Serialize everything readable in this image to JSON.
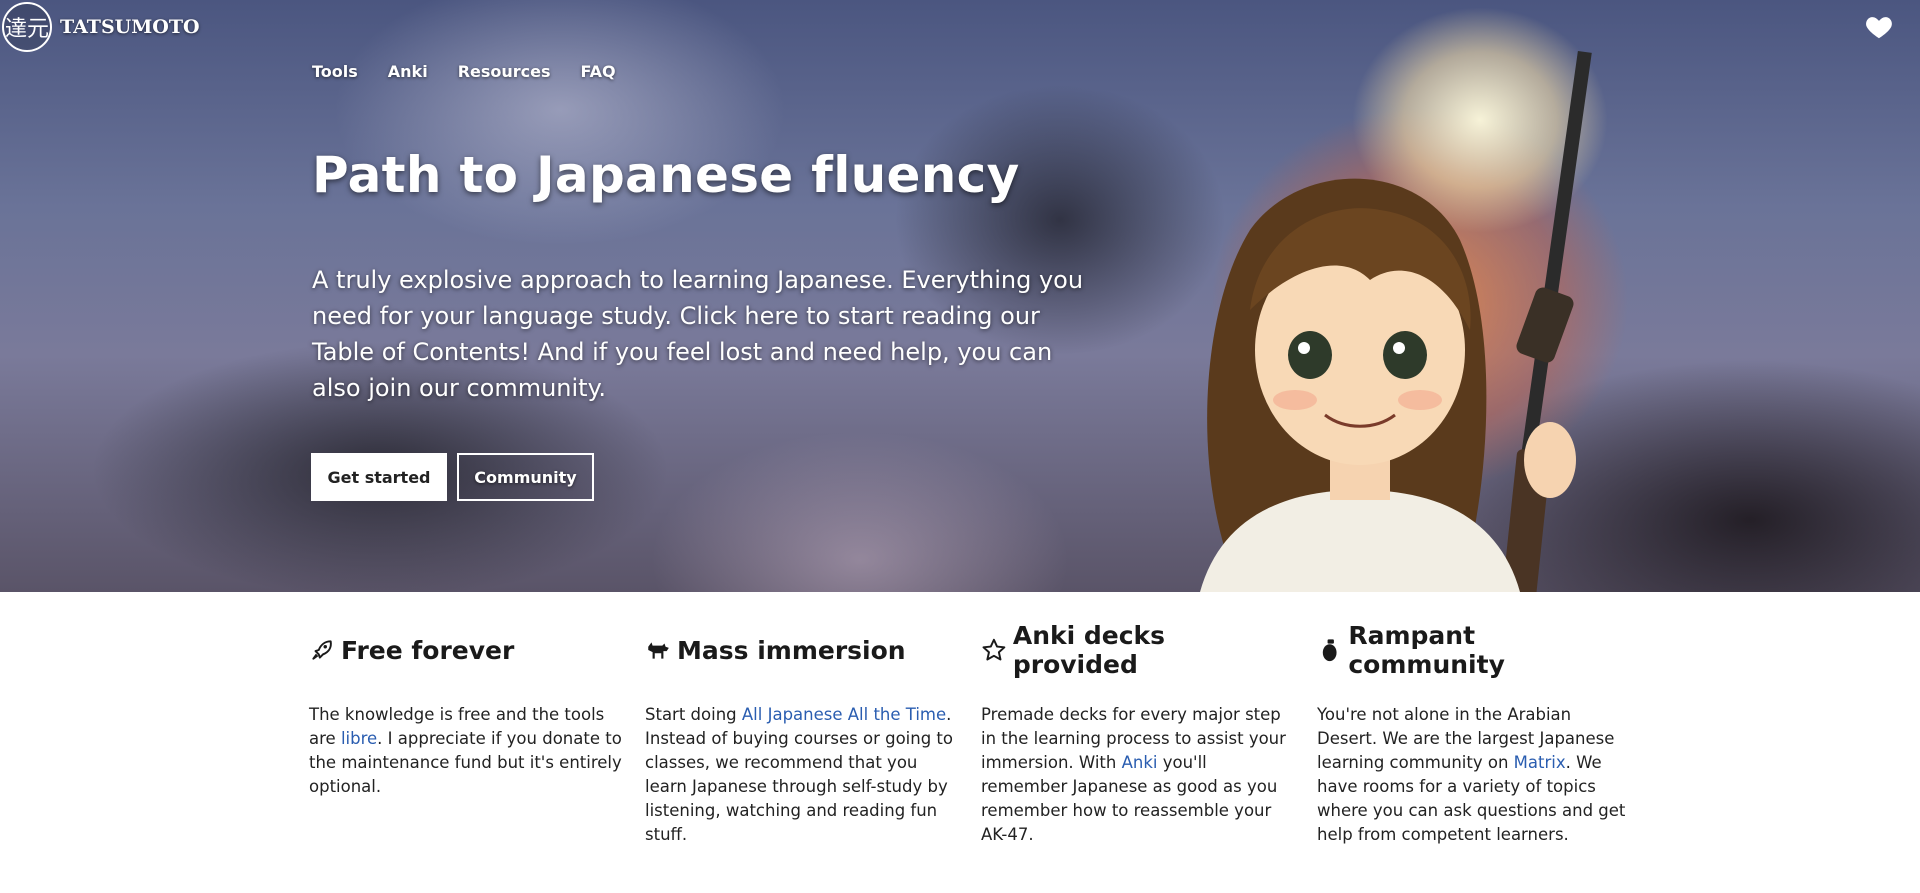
{
  "brand": {
    "mark": "達元",
    "name": "TATSUMOTO"
  },
  "nav": [
    {
      "label": "Tools"
    },
    {
      "label": "Anki"
    },
    {
      "label": "Resources"
    },
    {
      "label": "FAQ"
    }
  ],
  "hero": {
    "title": "Path to Japanese fluency",
    "lead": "A truly explosive approach to learning Japanese. Everything you need for your language study. Click here to start reading our Table of Contents! And if you feel lost and need help, you can also join our community.",
    "primary_button": "Get started",
    "secondary_button": "Community"
  },
  "features": [
    {
      "icon": "rocket-icon",
      "title": "Free forever",
      "p1": "The knowledge is free and the tools are ",
      "link": "libre",
      "p2": ". I appreciate if you donate to the maintenance fund but it's entirely optional."
    },
    {
      "icon": "goat-icon",
      "title": "Mass immersion",
      "p1": "Start doing ",
      "link": "All Japanese All the Time",
      "p2": ". Instead of buying courses or going to classes, we recommend that you learn Japanese through self-study by listening, watching and reading fun stuff."
    },
    {
      "icon": "star-icon",
      "title": "Anki decks provided",
      "p1": "Premade decks for every major step in the learning process to assist your immersion. With ",
      "link": "Anki",
      "p2": " you'll remember Japanese as good as you remember how to reassemble your AK-47."
    },
    {
      "icon": "grenade-icon",
      "title": "Rampant community",
      "p1": "You're not alone in the Arabian Desert. We are the largest Japanese learning community on ",
      "link": "Matrix",
      "p2": ". We have rooms for a variety of topics where you can ask questions and get help from competent learners."
    }
  ]
}
